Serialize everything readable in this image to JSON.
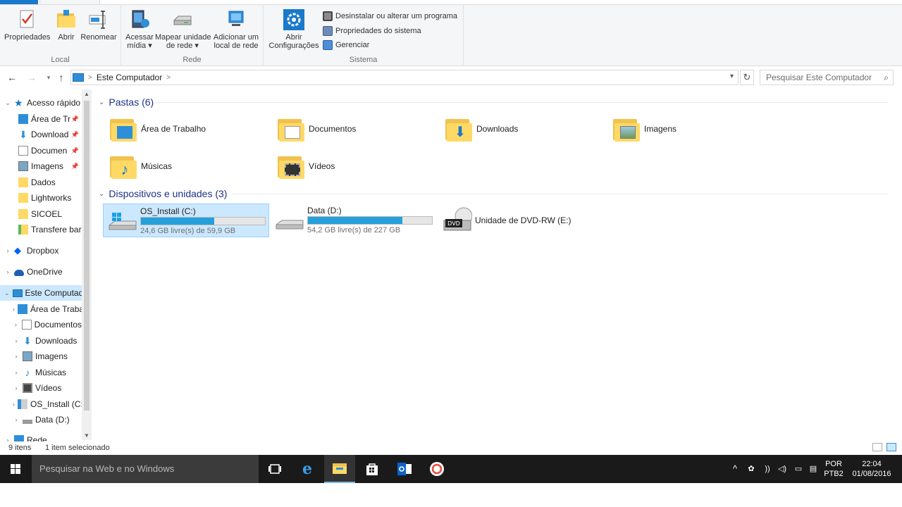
{
  "ribbon": {
    "groups": {
      "local": "Local",
      "network": "Rede",
      "system": "Sistema"
    },
    "buttons": {
      "properties": "Propriedades",
      "open": "Abrir",
      "rename": "Renomear",
      "access_media": "Acessar",
      "access_media_2": "mídia ▾",
      "map_drive": "Mapear unidade",
      "map_drive_2": "de rede ▾",
      "add_location": "Adicionar um",
      "add_location_2": "local de rede",
      "open_settings": "Abrir",
      "open_settings_2": "Configurações"
    },
    "small_buttons": {
      "uninstall": "Desinstalar ou alterar um programa",
      "sys_props": "Propriedades do sistema",
      "manage": "Gerenciar"
    }
  },
  "address": {
    "path": "Este Computador",
    "separator": ">",
    "search_placeholder": "Pesquisar Este Computador"
  },
  "sidebar": {
    "quick_access": "Acesso rápido",
    "items": [
      {
        "label": "Área de Tr",
        "pinned": true
      },
      {
        "label": "Download",
        "pinned": true
      },
      {
        "label": "Documen",
        "pinned": true
      },
      {
        "label": "Imagens",
        "pinned": true
      },
      {
        "label": "Dados"
      },
      {
        "label": "Lightworks"
      },
      {
        "label": "SICOEL"
      },
      {
        "label": "Transfere bar"
      }
    ],
    "dropbox": "Dropbox",
    "onedrive": "OneDrive",
    "this_pc": "Este Computad",
    "pc_items": [
      {
        "label": "Área de Traba"
      },
      {
        "label": "Documentos"
      },
      {
        "label": "Downloads"
      },
      {
        "label": "Imagens"
      },
      {
        "label": "Músicas"
      },
      {
        "label": "Vídeos"
      },
      {
        "label": "OS_Install (C:"
      },
      {
        "label": "Data (D:)"
      }
    ],
    "network": "Rede"
  },
  "content": {
    "folders_header": "Pastas (6)",
    "folders": [
      {
        "name": "Área de Trabalho"
      },
      {
        "name": "Documentos"
      },
      {
        "name": "Downloads"
      },
      {
        "name": "Imagens"
      },
      {
        "name": "Músicas"
      },
      {
        "name": "Vídeos"
      }
    ],
    "devices_header": "Dispositivos e unidades (3)",
    "drives": [
      {
        "name": "OS_Install (C:)",
        "free": "24,6 GB livre(s) de 59,9 GB",
        "used_fraction": 0.59
      },
      {
        "name": "Data (D:)",
        "free": "54,2 GB livre(s) de 227 GB",
        "used_fraction": 0.76
      },
      {
        "name": "Unidade de DVD-RW (E:)",
        "dvd_label": "DVD"
      }
    ]
  },
  "status": {
    "items": "9 itens",
    "selected": "1 item selecionado"
  },
  "taskbar": {
    "search": "Pesquisar na Web e no Windows",
    "lang_1": "POR",
    "lang_2": "PTB2",
    "time": "22:04",
    "date": "01/08/2016"
  },
  "colors": {
    "accent": "#1979ca",
    "drive_bar": "#26a0da",
    "selection": "#cce8ff"
  }
}
